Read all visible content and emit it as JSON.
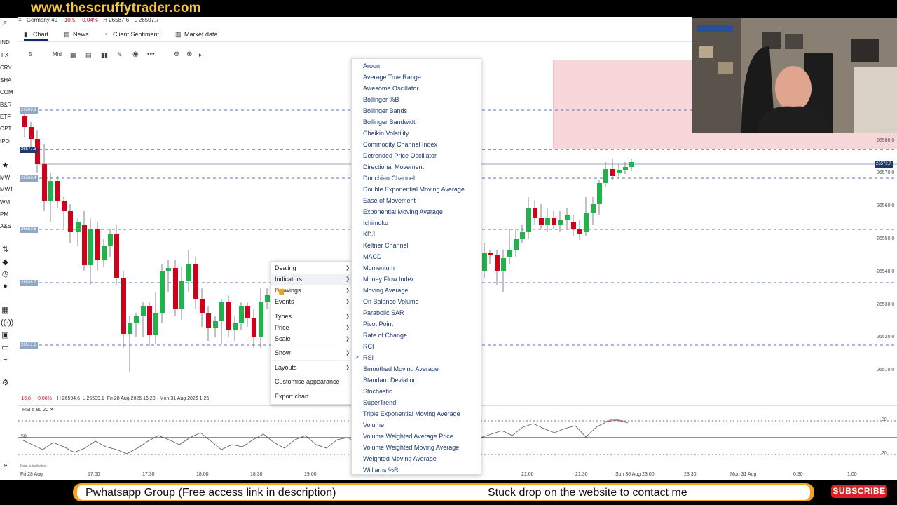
{
  "banner": {
    "site_url": "www.thescruffytrader.com"
  },
  "instrument": {
    "name": "Germany 40",
    "change": "-10.5",
    "change_pct": "-0.04%",
    "high": "H 26587.6",
    "low": "L 26507.7"
  },
  "left_nav": {
    "items": [
      "IND",
      "FX",
      "CRY",
      "SHA",
      "COM",
      "B&R",
      "ETF",
      "OPT",
      "IPO",
      "MW",
      "MW1",
      "WM",
      "PM",
      "A&S"
    ]
  },
  "tabs": [
    {
      "label": "Chart",
      "icon": "chart-icon"
    },
    {
      "label": "News",
      "icon": "news-icon"
    },
    {
      "label": "Client Sentiment",
      "icon": "sentiment-icon"
    },
    {
      "label": "Market data",
      "icon": "market-data-icon"
    }
  ],
  "toolbar": {
    "timeframe": "5 Mins",
    "price_type": "Mid"
  },
  "price_labels": {
    "left": [
      "26589.1",
      "26577.3",
      "26568.4",
      "26552.8",
      "26536.7",
      "26517.5"
    ],
    "right": [
      "26580.0",
      "26572.7",
      "26570.0",
      "26560.0",
      "26550.0",
      "26540.0",
      "26530.0",
      "26520.0",
      "26510.0"
    ]
  },
  "status": {
    "change": "-16.8",
    "change_pct": "-0.06%",
    "high": "H 26594.6",
    "low": "L 26509.1",
    "range": "Fri 28 Aug 2026 16:20 - Mon 31 Aug 2026 1:25"
  },
  "rsi": {
    "title": "RSI 5 80 20",
    "level_50": "50",
    "level_80": "80",
    "level_20": "20",
    "disclaimer": "Data is indicative"
  },
  "x_axis": [
    "Fri 28 Aug",
    "17:00",
    "17:30",
    "18:00",
    "18:30",
    "19:00",
    "21:00",
    "21:30",
    "Sun 30 Aug 23:00",
    "23:30",
    "Mon 31 Aug",
    "0:30",
    "1:00"
  ],
  "context_menu": {
    "items": [
      "Dealing",
      "Indicators",
      "Drawings",
      "Events",
      "Types",
      "Price",
      "Scale",
      "Show",
      "Layouts",
      "Customise appearance",
      "Export chart"
    ]
  },
  "indicators_menu": {
    "items": [
      "Aroon",
      "Average True Range",
      "Awesome Oscillator",
      "Bollinger %B",
      "Bollinger Bands",
      "Bollinger Bandwidth",
      "Chaikin Volatility",
      "Commodity Channel Index",
      "Detrended Price Oscillator",
      "Directional Movement",
      "Donchian Channel",
      "Double Exponential Moving Average",
      "Ease of Movement",
      "Exponential Moving Average",
      "Ichimoku",
      "KDJ",
      "Keltner Channel",
      "MACD",
      "Momentum",
      "Money Flow Index",
      "Moving Average",
      "On Balance Volume",
      "Parabolic SAR",
      "Pivot Point",
      "Rate of Change",
      "RCI",
      "RSI",
      "Smoothed Moving Average",
      "Standard Deviation",
      "Stochastic",
      "SuperTrend",
      "Triple Exponential Moving Average",
      "Volume",
      "Volume Weighted Average Price",
      "Volume Weighted Moving Average",
      "Weighted Moving Average",
      "Williams %R"
    ],
    "checked": "RSI"
  },
  "bottom_banner": {
    "left_text": "Pwhatsapp Group  (Free access link in description)",
    "right_text": "Stuck drop on the website to contact me",
    "subscribe": "SUBSCRIBE"
  },
  "colors": {
    "bull": "#22b14c",
    "bear": "#d0021b",
    "accent": "#0d2c6c",
    "banner_text": "#f4c542"
  }
}
